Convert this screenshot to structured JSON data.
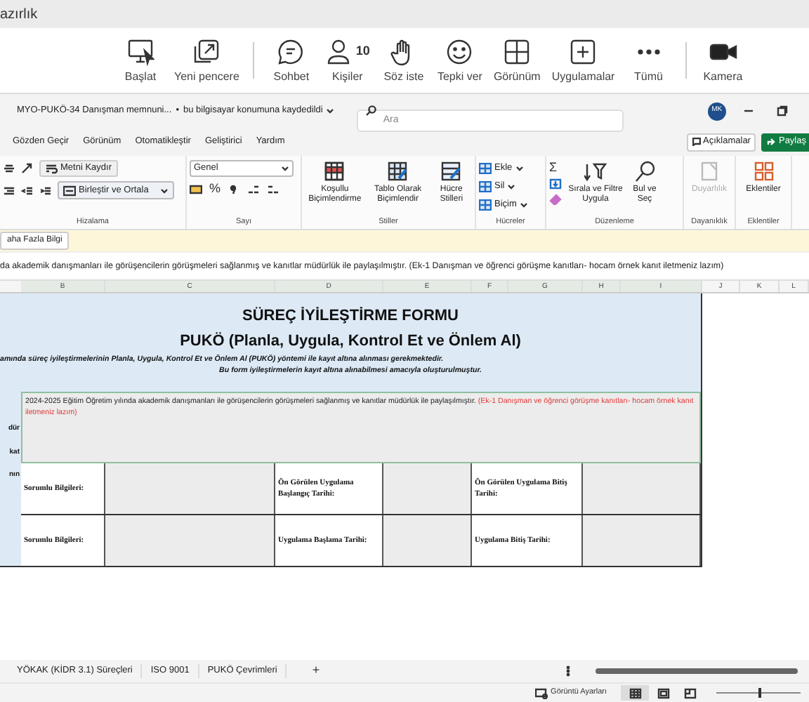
{
  "meeting_window": {
    "title": "azırlık"
  },
  "meeting_toolbar": [
    {
      "kind": "share",
      "label": "Başlat"
    },
    {
      "kind": "popout",
      "label": "Yeni pencere"
    },
    {
      "kind": "chat",
      "label": "Sohbet"
    },
    {
      "kind": "people",
      "label": "Kişiler",
      "count": "10"
    },
    {
      "kind": "hand",
      "label": "Söz iste"
    },
    {
      "kind": "react",
      "label": "Tepki ver"
    },
    {
      "kind": "view",
      "label": "Görünüm"
    },
    {
      "kind": "apps",
      "label": "Uygulamalar"
    },
    {
      "kind": "more",
      "label": "Tümü"
    },
    {
      "kind": "camera",
      "label": "Kamera"
    }
  ],
  "excel": {
    "file_name": "MYO-PUKÖ-34 Danışman memnuni...",
    "separator": "•",
    "save_status": "bu bilgisayar konumuna kaydedildi",
    "search": {
      "placeholder": "Ara"
    },
    "avatar": "MK"
  },
  "ribbon_tabs": [
    {
      "label": "Gözden Geçir",
      "selected": false
    },
    {
      "label": "Görünüm",
      "selected": false
    },
    {
      "label": "Otomatikleştir",
      "selected": false
    },
    {
      "label": "Geliştirici",
      "selected": false
    },
    {
      "label": "Yardım",
      "selected": false
    }
  ],
  "comments_button": "Açıklamalar",
  "share_button": "Paylaş",
  "ribbon": {
    "alignment": {
      "label": "Hizalama",
      "wrap_text": "Metni Kaydır",
      "merge_center": "Birleştir ve Ortala"
    },
    "number": {
      "label": "Sayı",
      "format": "Genel",
      "percent": "%"
    },
    "styles": {
      "label": "Stiller",
      "buttons": [
        "Koşullu Biçimlendirme",
        "Tablo Olarak Biçimlendir",
        "Hücre Stilleri"
      ]
    },
    "cells": {
      "label": "Hücreler",
      "buttons": [
        "Ekle",
        "Sil",
        "Biçim"
      ]
    },
    "editing": {
      "label": "Düzenleme",
      "sum": "Σ",
      "buttons": [
        "Sırala ve Filtre Uygula",
        "Bul ve Seç"
      ]
    },
    "sensitivity": {
      "label": "Dayanıklık",
      "button": "Duyarlılık",
      "disabled": true
    },
    "add_ins": {
      "label": "Eklentiler",
      "button": "Eklentiler"
    }
  },
  "message_bar": {
    "button": "aha Fazla Bilgi"
  },
  "formula_bar": {
    "value": "da akademik danışmanları ile görüşencilerin görüşmeleri sağlanmış ve kanıtlar müdürlük ile paylaşılmıştır. (Ek-1 Danışman ve öğrenci görüşme kanıtları- hocam örnek kanıt iletmeniz lazım)"
  },
  "columns": [
    "B",
    "C",
    "D",
    "E",
    "F",
    "G",
    "H",
    "I",
    "J",
    "K",
    "L"
  ],
  "form": {
    "title": "SÜREÇ İYİLEŞTİRME FORMU",
    "subtitle": "PUKÖ (Planla, Uygula, Kontrol Et ve Önlem Al)",
    "note_1": "amında süreç iyileştirmelerinin Planla, Uygula, Kontrol Et ve Önlem Al (PUKÖ) yöntemi ile kayıt altına alınması gerekmektedir.",
    "note_2": "Bu form iyileştirmelerin kayıt altına alınabilmesi amacıyla oluşturulmuştur.",
    "side_labels": [
      "dür",
      "kat",
      "nın"
    ],
    "description": "2024-2025 Eğitim Öğretim yılında akademik danışmanları ile görüşencilerin görüşmeleri sağlanmış ve kanıtlar müdürlük ile paylaşılmıştır. ",
    "description_note": "(Ek-1 Danışman ve öğrenci görüşme kanıtları- hocam örnek kanıt iletmeniz lazım)",
    "rows": [
      [
        "Sorumlu Bilgileri:",
        "Ön Görülen Uygulama Başlangıç Tarihi:",
        "Ön Görülen Uygulama Bitiş Tarihi:"
      ],
      [
        "Sorumlu Bilgileri:",
        "Uygulama Başlama Tarihi:",
        "Uygulama Bitiş Tarihi:"
      ]
    ]
  },
  "sheet_tabs": [
    {
      "label": "YÖKAK (KİDR 3.1) Süreçleri",
      "selected": false
    },
    {
      "label": "ISO 9001",
      "selected": false
    },
    {
      "label": "PUKÖ Çevrimleri",
      "selected": false
    }
  ],
  "add_sheet": "+",
  "status_bar": {
    "display_settings": "Görüntü Ayarları",
    "zoom": {
      "level": 0.5
    }
  }
}
